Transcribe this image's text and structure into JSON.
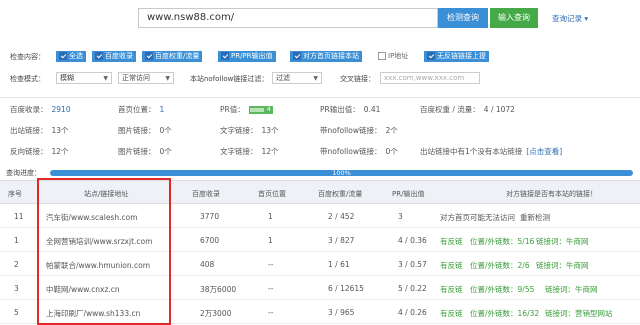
{
  "search": {
    "url": "www.nsw88.com/",
    "query_button": "检测查询",
    "enter_button": "输入查询",
    "history_link": "查询记录 ▾"
  },
  "options": {
    "check_content_label": "检查内容：",
    "checks": [
      {
        "label": "全选",
        "checked": true
      },
      {
        "label": "百度收录",
        "checked": true
      },
      {
        "label": "百度权重/流量",
        "checked": true
      },
      {
        "label": "PR/PR输出值",
        "checked": true
      },
      {
        "label": "对方首页链接本站",
        "checked": true
      },
      {
        "label": "IP地址",
        "checked": false
      },
      {
        "label": "无反链链接上提",
        "checked": true
      }
    ],
    "mode_label": "检查模式：",
    "mode_value": "模糊",
    "access_value": "正常访问",
    "nofollow_label": "本站nofollow链接过滤：",
    "nofollow_value": "过滤",
    "exchange_label": "交叉链接：",
    "exchange_placeholder": "xxx.com,www.xxx.com"
  },
  "stats": {
    "row1": [
      {
        "label": "百度收录：",
        "value": "2910"
      },
      {
        "label": "首页位置：",
        "value": "1"
      },
      {
        "label": "PR值：",
        "value": "4"
      },
      {
        "label": "PR输出值：",
        "value": "0.41"
      },
      {
        "label": "百度权重 / 流量：",
        "value": "4 / 1072"
      }
    ],
    "row2": [
      {
        "label": "出站链接：",
        "value": "13个"
      },
      {
        "label": "图片链接：",
        "value": "0个"
      },
      {
        "label": "文字链接：",
        "value": "13个"
      },
      {
        "label": "带nofollow链接：",
        "value": "2个"
      }
    ],
    "row3": [
      {
        "label": "反向链接：",
        "value": "12个"
      },
      {
        "label": "图片链接：",
        "value": "0个"
      },
      {
        "label": "文字链接：",
        "value": "12个"
      },
      {
        "label": "带nofollow链接：",
        "value": "0个"
      },
      {
        "label": "出站链接中有1个没有本站链接",
        "value": "[点击查看]"
      }
    ]
  },
  "progress": {
    "label": "查询进度：",
    "percent_text": "100%",
    "fraction": 1.0
  },
  "table": {
    "headers": [
      "序号",
      "站点/链接地址",
      "百度收录",
      "首页位置",
      "百度权重/流量",
      "PR/输出值",
      "对方链接是否有本站的链接！"
    ],
    "rows": [
      {
        "no": "11",
        "site": "汽车街/www.scalesh.com",
        "baidu": "3770",
        "pos": "1",
        "weight": "2 / 452",
        "pr": "3",
        "status": "对方首页可能无法访问",
        "extra": "重新检测",
        "extra2": ""
      },
      {
        "no": "1",
        "site": "全网营销培训/www.srzxjt.com",
        "baidu": "6700",
        "pos": "1",
        "weight": "3 / 827",
        "pr": "4 / 0.36",
        "status": "有反链",
        "extra": "位置/外链数：5/16",
        "extra2": "链接词：牛商网"
      },
      {
        "no": "2",
        "site": "帕蒙联合/www.hmunion.com",
        "baidu": "408",
        "pos": "--",
        "weight": "1 / 61",
        "pr": "3 / 0.57",
        "status": "有反链",
        "extra": "位置/外链数：2/6",
        "extra2": "链接词：牛商网"
      },
      {
        "no": "3",
        "site": "中鞋网/www.cnxz.cn",
        "baidu": "38万6000",
        "pos": "--",
        "weight": "6 / 12615",
        "pr": "5 / 0.22",
        "status": "有反链",
        "extra": "位置/外链数：9/55",
        "extra2": "链接词：牛商网"
      },
      {
        "no": "5",
        "site": "上海印刷厂/www.sh133.cn",
        "baidu": "2万3000",
        "pos": "--",
        "weight": "3 / 965",
        "pr": "4 / 0.26",
        "status": "有反链",
        "extra": "位置/外链数：16/32",
        "extra2": "链接词：营销型网站"
      }
    ]
  }
}
